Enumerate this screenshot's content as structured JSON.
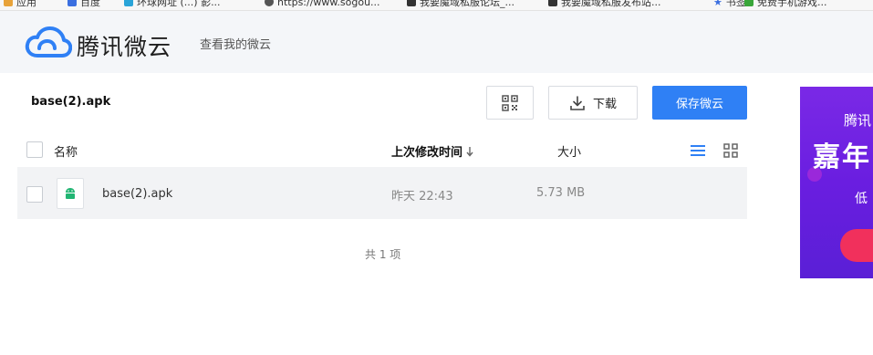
{
  "bookmarks": [
    {
      "label": "应用",
      "icon": "apps-icon",
      "color": "#e8a33a"
    },
    {
      "label": "百度",
      "icon": "baidu-icon",
      "color": "#3b6fe0"
    },
    {
      "label": "环球网址 (...) 影...",
      "icon": "globe-icon",
      "color": "#2aa4d8"
    },
    {
      "label": "https://www.sogou...",
      "icon": "sogou-icon",
      "color": "#555555"
    },
    {
      "label": "我要魔域私服论坛_...",
      "icon": "forum-icon",
      "color": "#333333"
    },
    {
      "label": "我要魔域私服发布站...",
      "icon": "forum-icon",
      "color": "#333333"
    },
    {
      "label": "书签",
      "icon": "star-icon",
      "color": "#3b6fe0"
    },
    {
      "label": "免费手机游戏...",
      "icon": "game-icon",
      "color": "#3aa63a"
    }
  ],
  "header": {
    "brand": "腾讯微云",
    "view_mine": "查看我的微云",
    "brand_color": "#2f80f5"
  },
  "toolbar": {
    "filename": "base(2).apk",
    "qr_icon": "qrcode-icon",
    "download_label": "下载",
    "save_label": "保存微云",
    "save_color": "#2f80f5"
  },
  "table": {
    "columns": {
      "name": "名称",
      "mtime": "上次修改时间",
      "size": "大小"
    },
    "sort": "descending",
    "view_mode": "list",
    "rows": [
      {
        "name": "base(2).apk",
        "mtime": "昨天 22:43",
        "size": "5.73 MB",
        "icon": "android-apk-icon"
      }
    ],
    "total": "共 1 项"
  },
  "ad": {
    "line1": "腾讯",
    "line2": "嘉年",
    "line3": "低",
    "bg_color": "#6a1ee0",
    "button_color": "#f1305c"
  }
}
